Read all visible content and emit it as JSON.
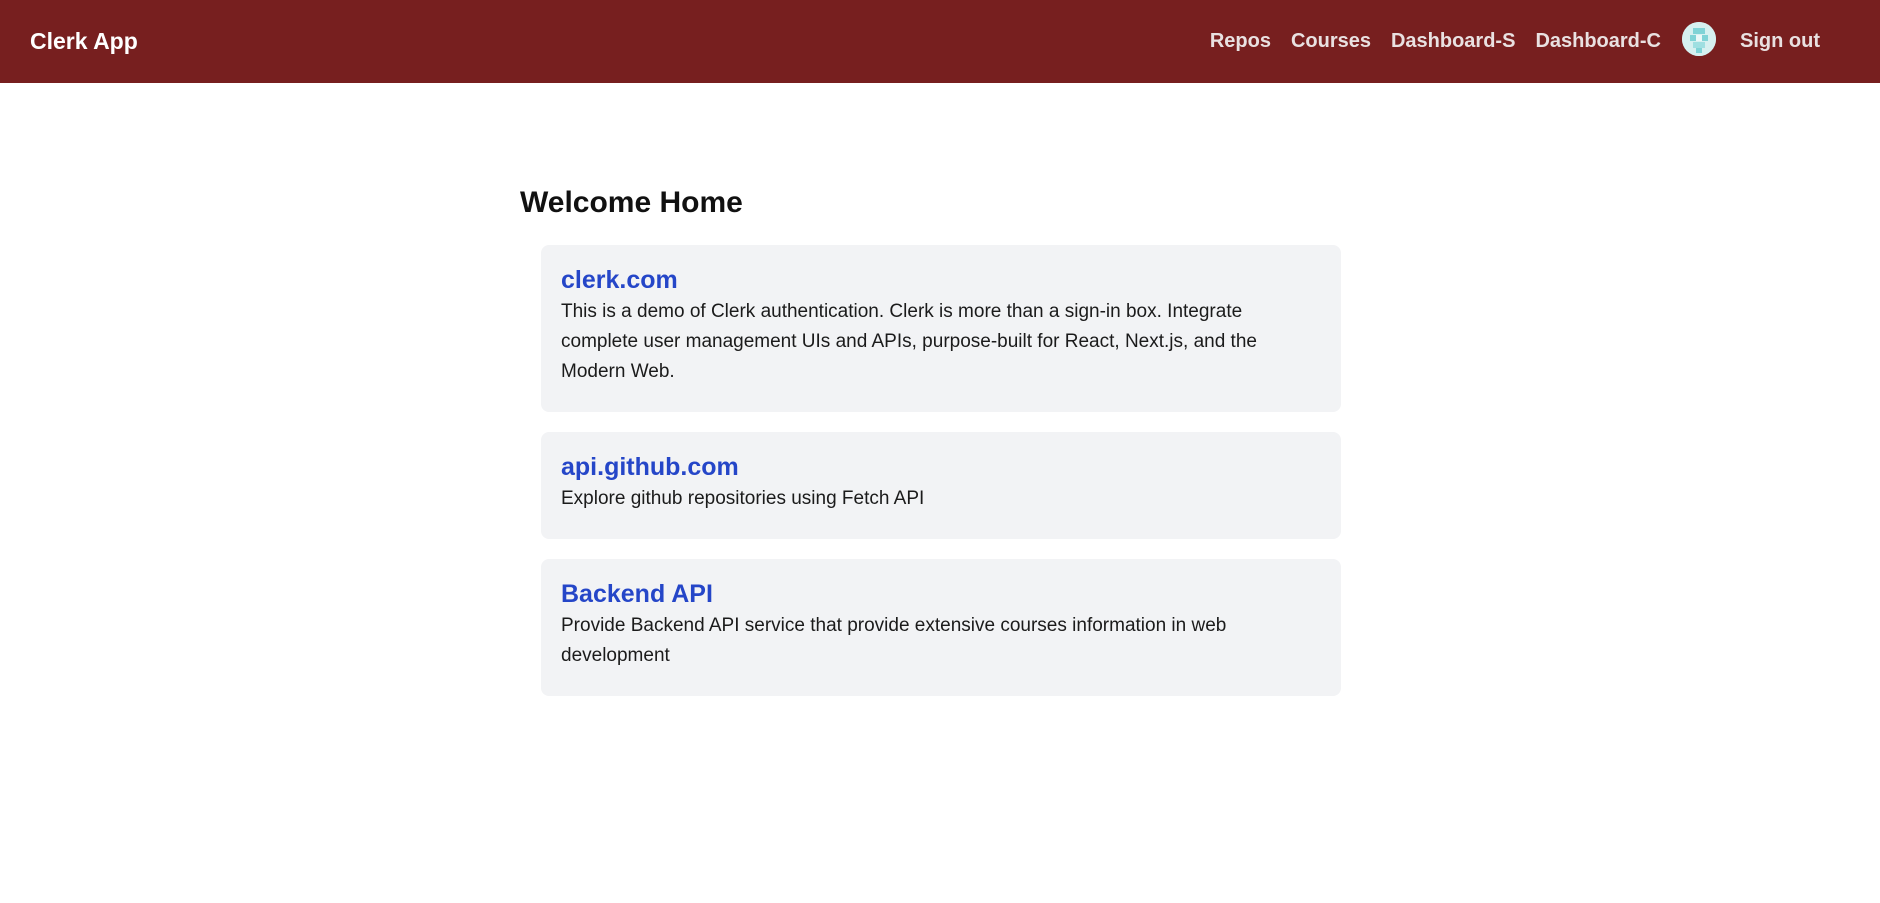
{
  "navbar": {
    "brand": "Clerk App",
    "links": [
      "Repos",
      "Courses",
      "Dashboard-S",
      "Dashboard-C"
    ],
    "sign_out": "Sign out",
    "avatar_icon": "user-avatar-icon"
  },
  "main": {
    "title": "Welcome Home",
    "cards": [
      {
        "title": "clerk.com",
        "description": "This is a demo of Clerk authentication. Clerk is more than a sign-in box. Integrate complete user management UIs and APIs, purpose-built for React, Next.js, and the Modern Web."
      },
      {
        "title": "api.github.com",
        "description": "Explore github repositories using Fetch API"
      },
      {
        "title": "Backend API",
        "description": "Provide Backend API service that provide extensive courses information in web development"
      }
    ]
  },
  "colors": {
    "navbar_bg": "#771f1f",
    "card_bg": "#f2f3f5",
    "link_blue": "#2546c8"
  }
}
